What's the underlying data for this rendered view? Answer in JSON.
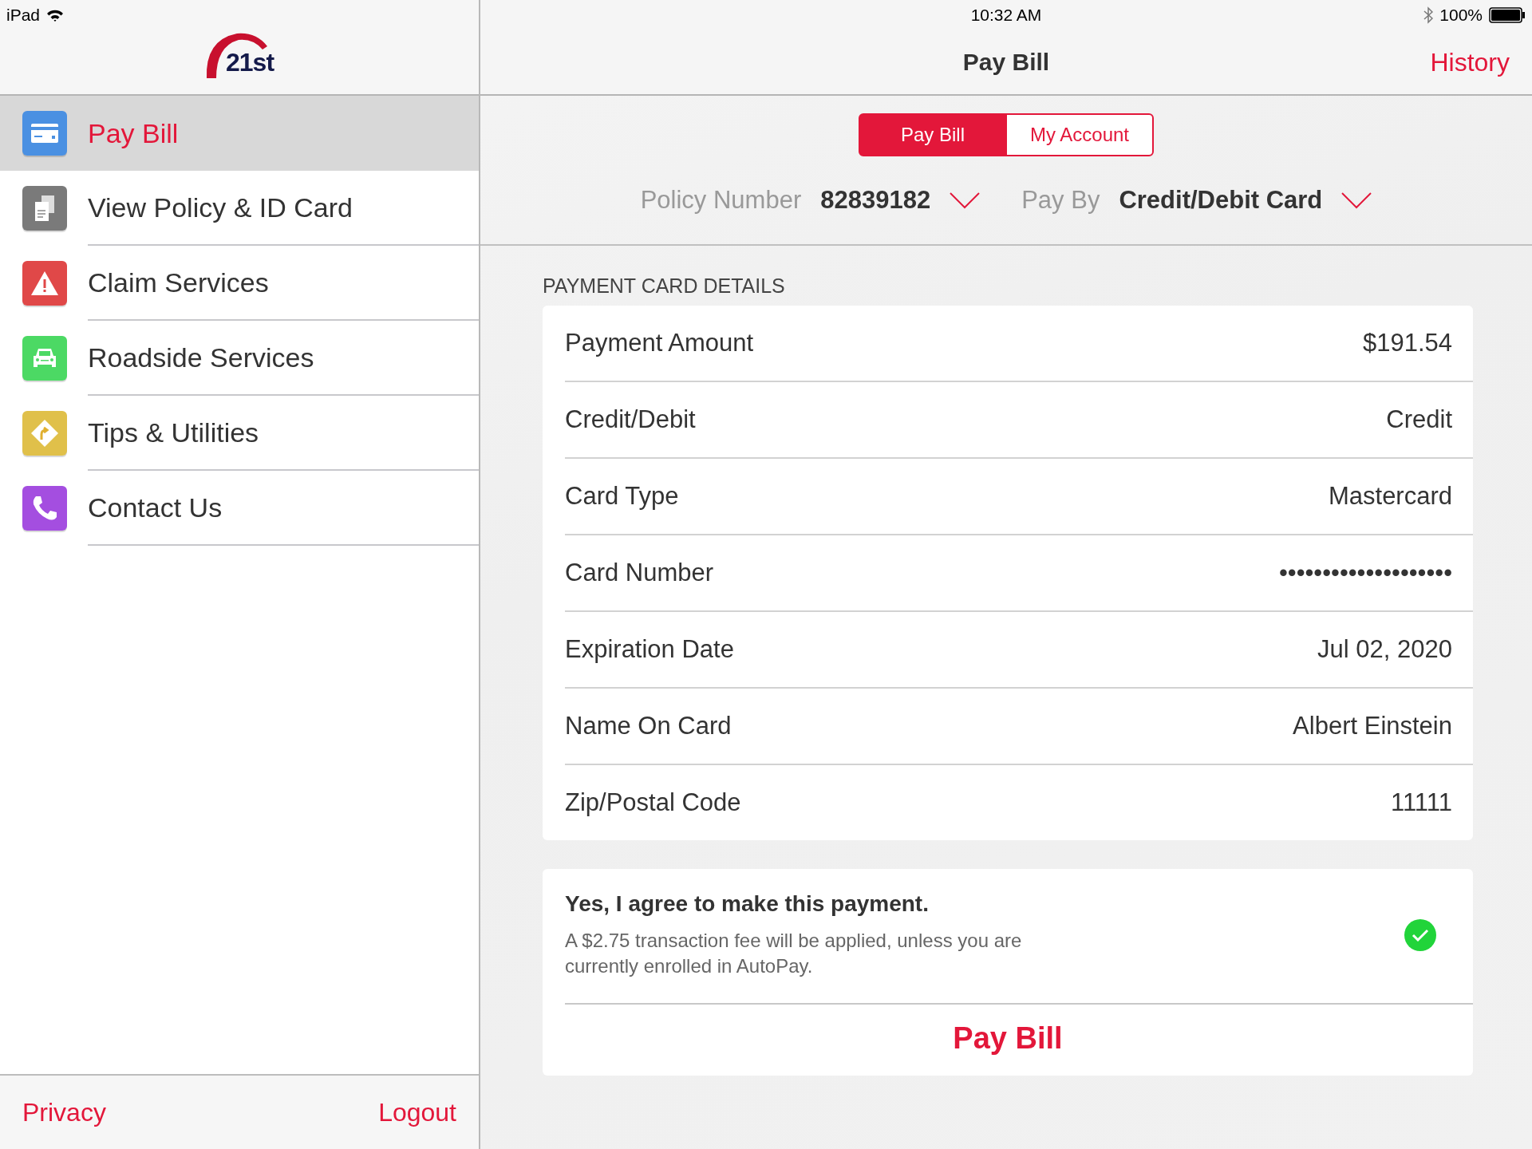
{
  "status_bar": {
    "device": "iPad",
    "time": "10:32 AM",
    "battery": "100%"
  },
  "sidebar": {
    "logo": "21st",
    "items": [
      {
        "label": "Pay Bill",
        "kind": "card",
        "color": "#4a90e2",
        "selected": true
      },
      {
        "label": "View Policy & ID Card",
        "kind": "document",
        "color": "#7a7a7a",
        "selected": false
      },
      {
        "label": "Claim Services",
        "kind": "warning",
        "color": "#e04848",
        "selected": false
      },
      {
        "label": "Roadside Services",
        "kind": "car",
        "color": "#4cd964",
        "selected": false
      },
      {
        "label": "Tips & Utilities",
        "kind": "sign",
        "color": "#e0c04a",
        "selected": false
      },
      {
        "label": "Contact Us",
        "kind": "phone",
        "color": "#a44ee0",
        "selected": false
      }
    ],
    "footer": [
      "Privacy",
      "Logout"
    ]
  },
  "nav": {
    "title": "Pay Bill",
    "action": "History"
  },
  "segments": [
    {
      "label": "Pay Bill",
      "selected": true
    },
    {
      "label": "My Account",
      "selected": false
    }
  ],
  "selectors": [
    {
      "label": "Policy Number",
      "value": "82839182"
    },
    {
      "label": "Pay By",
      "value": "Credit/Debit Card"
    }
  ],
  "section_title": "PAYMENT CARD DETAILS",
  "details": [
    {
      "label": "Payment Amount",
      "value": "$191.54"
    },
    {
      "label": "Credit/Debit",
      "value": "Credit"
    },
    {
      "label": "Card Type",
      "value": "Mastercard"
    },
    {
      "label": "Card Number",
      "value": "••••••••••••••••••••"
    },
    {
      "label": "Expiration Date",
      "value": "Jul 02, 2020"
    },
    {
      "label": "Name On Card",
      "value": "Albert Einstein"
    },
    {
      "label": "Zip/Postal Code",
      "value": "11111"
    }
  ],
  "agreement": {
    "title": "Yes, I agree to make this payment.",
    "note": "A $2.75 transaction fee will be applied, unless you are currently enrolled in AutoPay.",
    "checked": true
  },
  "submit": "Pay Bill"
}
